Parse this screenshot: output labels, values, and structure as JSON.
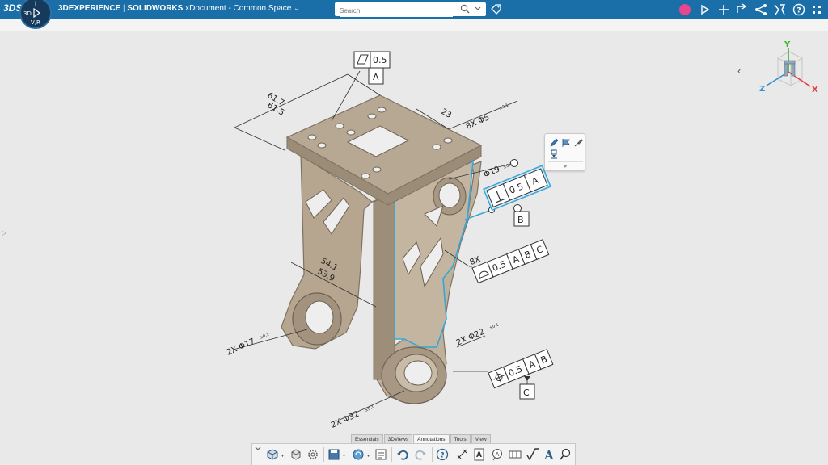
{
  "app": {
    "brand_logo": "3DS",
    "title_prefix": "3DEXPERIENCE",
    "title_sep": "|",
    "title_app": "SOLIDWORKS",
    "title_doc": "xDocument - Common Space",
    "compass_labels": {
      "top": "i",
      "left": "3D",
      "right": "",
      "bottom": "V,R"
    }
  },
  "search": {
    "placeholder": "Search"
  },
  "topbar_icons": [
    "avatar-dot",
    "share-icon",
    "add-icon",
    "home-icon",
    "network-icon",
    "tools-icon",
    "help-icon",
    "apps-icon"
  ],
  "cube": {
    "y": "Y",
    "x": "X",
    "z": "Z"
  },
  "annotations": {
    "flatness": "0.5",
    "datum_a": "A",
    "dim_top_1": "61.7",
    "dim_top_2": "61.5",
    "dim_23": "23",
    "holes_8x": "8X Φ5",
    "holes_8x_tol": "±0.1",
    "dia19": "Φ19",
    "dia19_tol": "±0.1",
    "perp_value": "0.5",
    "perp_datum": "A",
    "datum_b": "B",
    "profile_mult": "8X",
    "profile_value": "0.5",
    "profile_datums": [
      "A",
      "B",
      "C"
    ],
    "dim_side_1": "54.1",
    "dim_side_2": "53.9",
    "dia17": "2X Φ17",
    "dia17_tol": "±0.1",
    "dia22": "2X Φ22",
    "dia22_tol": "±0.1",
    "pos_value": "0.5",
    "pos_datums": [
      "A",
      "B"
    ],
    "datum_c": "C",
    "dia32": "2X Φ32",
    "dia32_tol": "±0.1"
  },
  "tabs": [
    {
      "label": "Essentials",
      "active": false
    },
    {
      "label": "3DViews",
      "active": false
    },
    {
      "label": "Annotations",
      "active": true
    },
    {
      "label": "Tools",
      "active": false
    },
    {
      "label": "View",
      "active": false
    }
  ],
  "colors": {
    "topbar": "#1b6fa8",
    "part": "#b9aa94",
    "part_dark": "#8c7f6d",
    "highlight": "#37a7d8",
    "avatar": "#e8478b"
  }
}
